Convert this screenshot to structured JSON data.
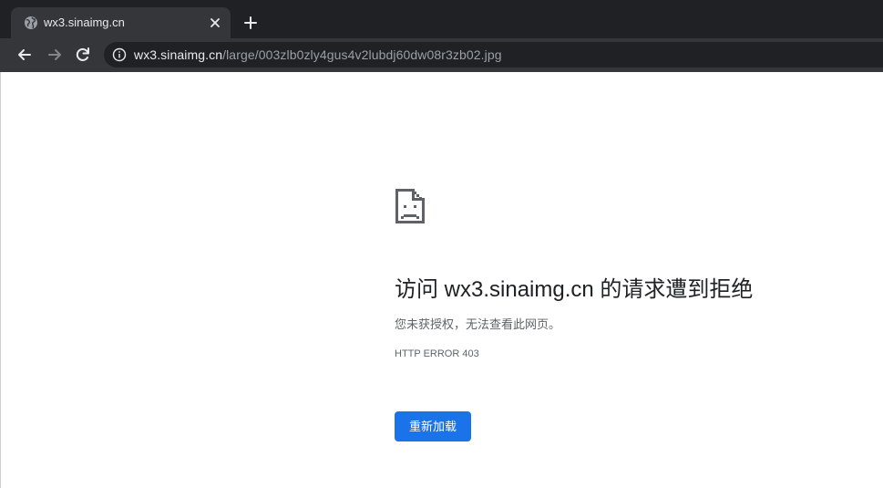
{
  "browser": {
    "tab": {
      "title": "wx3.sinaimg.cn",
      "favicon": "globe-icon",
      "close_icon": "close-icon"
    },
    "new_tab_icon": "plus-icon",
    "toolbar": {
      "back_icon": "back-arrow-icon",
      "forward_icon": "forward-arrow-icon",
      "reload_icon": "reload-icon",
      "info_icon": "info-icon",
      "url_host": "wx3.sinaimg.cn",
      "url_path": "/large/003zlb0zly4gus4v2lubdj60dw08r3zb02.jpg"
    }
  },
  "page": {
    "icon": "sad-file-icon",
    "heading": "访问 wx3.sinaimg.cn 的请求遭到拒绝",
    "message": "您未获授权，无法查看此网页。",
    "error_code": "HTTP ERROR 403",
    "reload_label": "重新加载"
  },
  "colors": {
    "chrome_dark": "#202124",
    "tab_active": "#35363a",
    "button_blue": "#1a73e8",
    "heading_text": "#202124",
    "secondary_text": "#5f6368"
  }
}
